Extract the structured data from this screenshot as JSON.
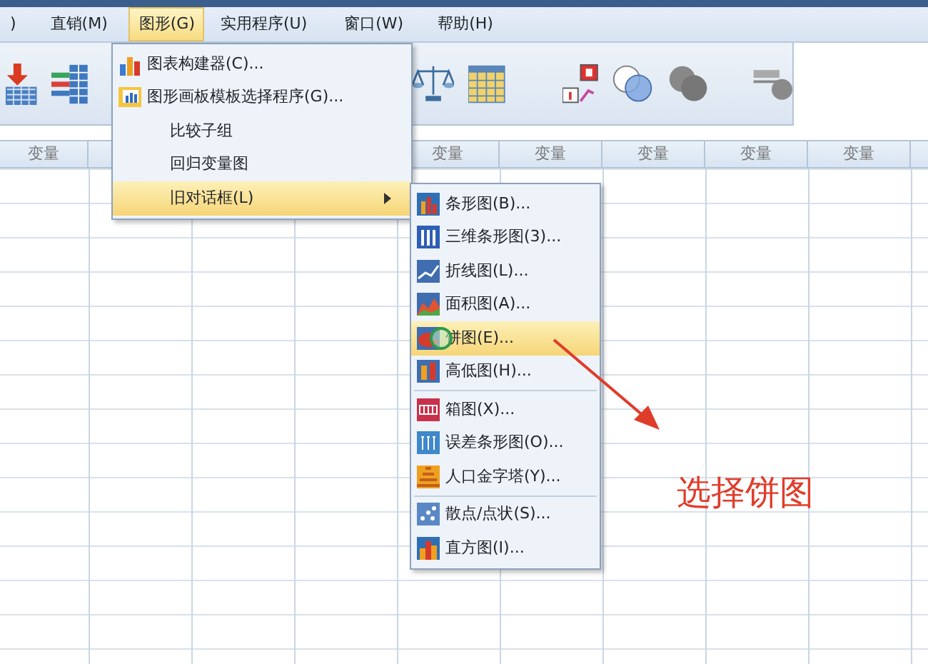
{
  "menu_bar": [
    {
      "label": ")",
      "selected": false
    },
    {
      "label": "直销(M)",
      "selected": false
    },
    {
      "label": "图形(G)",
      "selected": true
    },
    {
      "label": "实用程序(U)",
      "selected": false
    },
    {
      "label": "窗口(W)",
      "selected": false
    },
    {
      "label": "帮助(H)",
      "selected": false
    }
  ],
  "table": {
    "columns": [
      "变量",
      "变量",
      "变量",
      "变量",
      "变量",
      "变量"
    ]
  },
  "graphs_menu": [
    {
      "label": "图表构建器(C)...",
      "kind": "bars",
      "selected": false,
      "has_submenu": false
    },
    {
      "label": "图形画板模板选择程序(G)...",
      "kind": "board",
      "selected": false,
      "has_submenu": false
    },
    {
      "label": "比较子组",
      "kind": "plain",
      "selected": false,
      "has_submenu": false
    },
    {
      "label": "回归变量图",
      "kind": "plain",
      "selected": false,
      "has_submenu": false
    },
    {
      "label": "旧对话框(L)",
      "kind": "plain",
      "selected": true,
      "has_submenu": true
    }
  ],
  "legacy_dialogs_menu": [
    [
      {
        "label": "条形图(B)...",
        "kind": "bar",
        "selected": false
      },
      {
        "label": "三维条形图(3)...",
        "kind": "bar3d",
        "selected": false
      },
      {
        "label": "折线图(L)...",
        "kind": "line",
        "selected": false
      },
      {
        "label": "面积图(A)...",
        "kind": "area",
        "selected": false
      },
      {
        "label": "饼图(E)...",
        "kind": "pie",
        "selected": true
      },
      {
        "label": "高低图(H)...",
        "kind": "highlow",
        "selected": false
      }
    ],
    [
      {
        "label": "箱图(X)...",
        "kind": "box",
        "selected": false
      },
      {
        "label": "误差条形图(O)...",
        "kind": "error",
        "selected": false
      },
      {
        "label": "人口金字塔(Y)...",
        "kind": "pyramid",
        "selected": false
      }
    ],
    [
      {
        "label": "散点/点状(S)...",
        "kind": "scatter",
        "selected": false
      },
      {
        "label": "直方图(I)...",
        "kind": "hist",
        "selected": false
      }
    ]
  ],
  "annotation": {
    "text": "选择饼图"
  }
}
